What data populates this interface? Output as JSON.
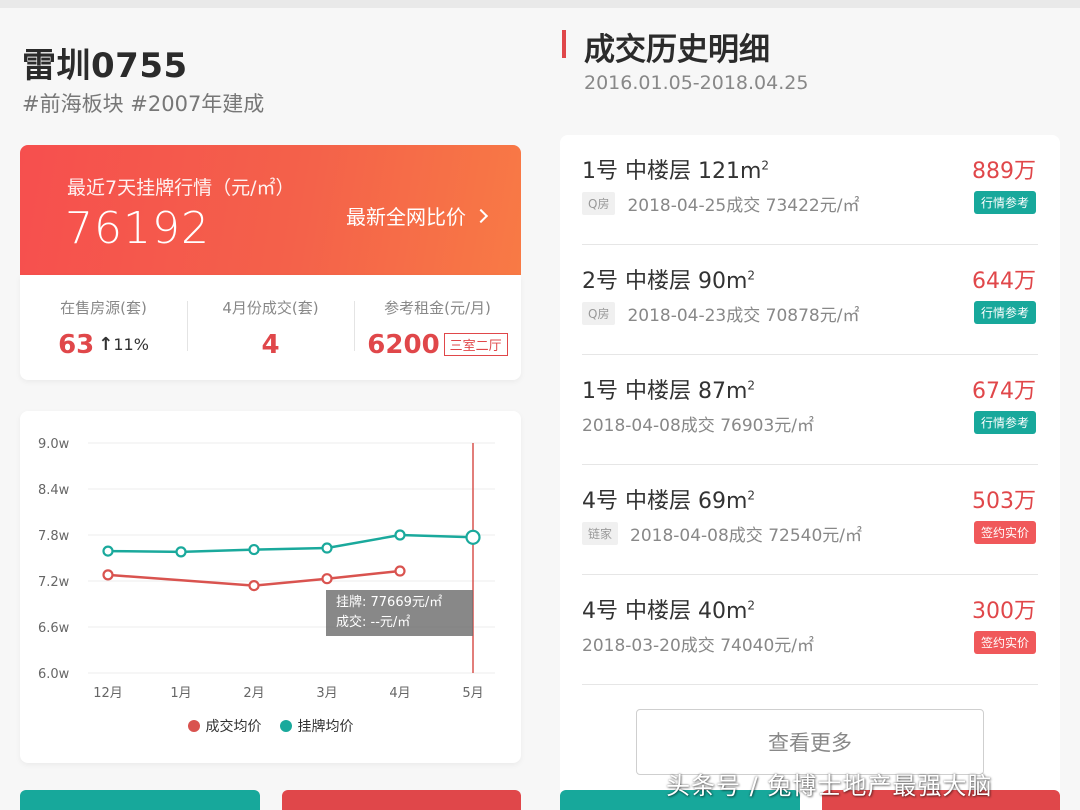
{
  "colors": {
    "accent": "#e0474a",
    "teal": "#17a89b",
    "price_card_start": "#f64f4e",
    "price_card_end": "#f87a45",
    "deal_line": "#d9534f",
    "list_line": "#1aa99c"
  },
  "property": {
    "name": "雷圳0755",
    "tags": "#前海板块 #2007年建成"
  },
  "price_card": {
    "label": "最近7天挂牌行情（元/㎡）",
    "value": "76192",
    "compare_link": "最新全网比价"
  },
  "stats": [
    {
      "label": "在售房源(套)",
      "value": "63",
      "change": "11%",
      "change_icon": "arrow-up"
    },
    {
      "label": "4月份成交(套)",
      "value": "4"
    },
    {
      "label": "参考租金(元/月)",
      "value": "6200",
      "badge": "三室二厅"
    }
  ],
  "tooltip": {
    "line1": "挂牌: 77669元/㎡",
    "line2": "成交: --元/㎡"
  },
  "legend": {
    "deal": "成交均价",
    "list": "挂牌均价"
  },
  "chart_data": {
    "type": "line",
    "categories": [
      "12月",
      "1月",
      "2月",
      "3月",
      "4月",
      "5月"
    ],
    "y_tick_labels": [
      "9.0w",
      "8.4w",
      "7.8w",
      "7.2w",
      "6.6w",
      "6.0w"
    ],
    "ylim": [
      6.0,
      9.0
    ],
    "grid": true,
    "legend_position": "bottom",
    "series": [
      {
        "name": "成交均价",
        "color": "#d9534f",
        "values": [
          7.28,
          null,
          7.14,
          7.23,
          7.33,
          null
        ]
      },
      {
        "name": "挂牌均价",
        "color": "#1aa99c",
        "values": [
          7.59,
          7.58,
          7.61,
          7.63,
          7.8,
          7.77
        ]
      }
    ]
  },
  "history": {
    "title": "成交历史明细",
    "date_range": "2016.01.05-2018.04.25",
    "items": [
      {
        "title": "1号 中楼层 121m",
        "price": "889万",
        "source": "Q房",
        "meta": "2018-04-25成交  73422元/㎡",
        "tag": "行情参考",
        "tag_type": "ref"
      },
      {
        "title": "2号 中楼层 90m",
        "price": "644万",
        "source": "Q房",
        "meta": "2018-04-23成交  70878元/㎡",
        "tag": "行情参考",
        "tag_type": "ref"
      },
      {
        "title": "1号 中楼层 87m",
        "price": "674万",
        "source": "",
        "meta": "2018-04-08成交  76903元/㎡",
        "tag": "行情参考",
        "tag_type": "ref"
      },
      {
        "title": "4号 中楼层 69m",
        "price": "503万",
        "source": "链家",
        "meta": "2018-04-08成交  72540元/㎡",
        "tag": "签约实价",
        "tag_type": "signed"
      },
      {
        "title": "4号 中楼层 40m",
        "price": "300万",
        "source": "",
        "meta": "2018-03-20成交  74040元/㎡",
        "tag": "签约实价",
        "tag_type": "signed"
      }
    ],
    "more_button": "查看更多"
  },
  "watermark": "头条号 / 兔博士地产最强大脑"
}
